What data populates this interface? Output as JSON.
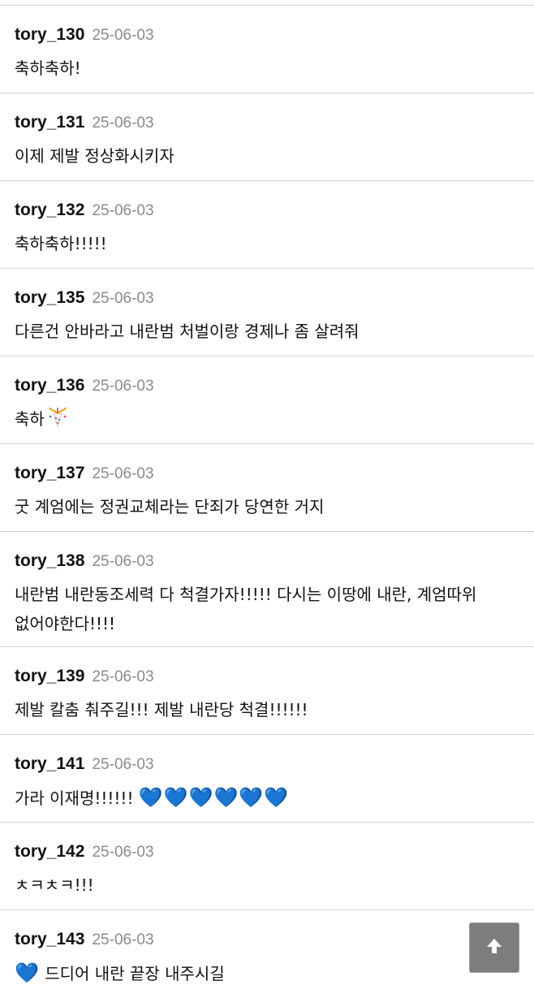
{
  "comments": [
    {
      "author": "tory_130",
      "date": "25-06-03",
      "text": "축하축하!"
    },
    {
      "author": "tory_131",
      "date": "25-06-03",
      "text": "이제 제발 정상화시키자"
    },
    {
      "author": "tory_132",
      "date": "25-06-03",
      "text": "축하축하!!!!!"
    },
    {
      "author": "tory_135",
      "date": "25-06-03",
      "text": "다른건 안바라고 내란범 처벌이랑 경제나 좀 살려줘"
    },
    {
      "author": "tory_136",
      "date": "25-06-03",
      "text": "축하"
    },
    {
      "author": "tory_137",
      "date": "25-06-03",
      "text": "굿 계엄에는 정권교체라는 단죄가 당연한 거지"
    },
    {
      "author": "tory_138",
      "date": "25-06-03",
      "text": "내란범 내란동조세력 다 척결가자!!!!! 다시는 이땅에 내란, 계엄따위 없어야한다!!!!"
    },
    {
      "author": "tory_139",
      "date": "25-06-03",
      "text": "제발 칼춤 춰주길!!! 제발 내란당 척결!!!!!!"
    },
    {
      "author": "tory_141",
      "date": "25-06-03",
      "text": "가라 이재명!!!!!! ",
      "emoji": "💙💙💙💙💙💙"
    },
    {
      "author": "tory_142",
      "date": "25-06-03",
      "text": "ㅊㅋㅊㅋ!!!"
    },
    {
      "author": "tory_143",
      "date": "25-06-03",
      "emoji_prefix": "💙",
      "text": " 드디어 내란 끝장 내주시길"
    }
  ],
  "icons": {
    "party": "party-popper-icon",
    "heart": "blue-heart-icon",
    "scroll_top": "arrow-up-icon"
  },
  "colors": {
    "author": "#111111",
    "date": "#8a8a8a",
    "divider": "#d6d6d6",
    "heart": "#1e6ff0",
    "scroll_top_bg": "#7d7d7d"
  }
}
